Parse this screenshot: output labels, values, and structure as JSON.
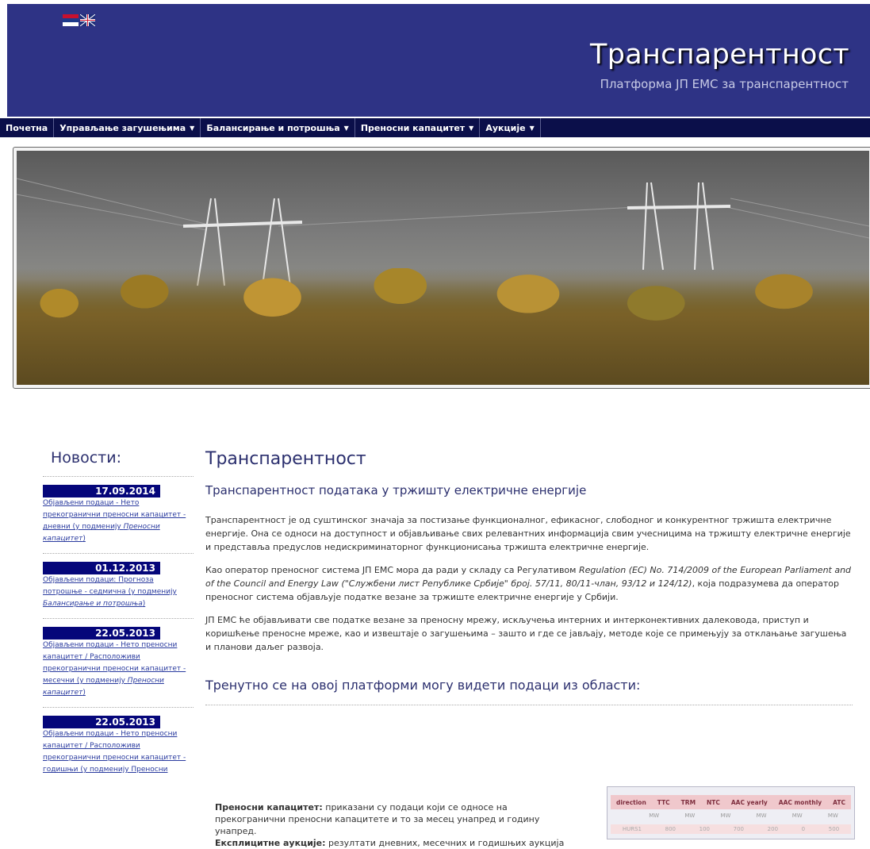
{
  "header": {
    "title": "Транспарентност",
    "subtitle": "Платформа ЈП ЕМС за транспарентност",
    "flags": [
      "serbian-flag-icon",
      "uk-flag-icon"
    ]
  },
  "nav": {
    "items": [
      {
        "label": "Почетна",
        "dropdown": false
      },
      {
        "label": "Управљање загушењима",
        "dropdown": true
      },
      {
        "label": "Балансирање и потрошња",
        "dropdown": true
      },
      {
        "label": "Преносни капацитет",
        "dropdown": true
      },
      {
        "label": "Аукције",
        "dropdown": true
      }
    ],
    "arrow": "▼"
  },
  "news": {
    "heading": "Новости:",
    "items": [
      {
        "date": "17.09.2014",
        "text": "Објављени подаци - Нето прекогранични преносни капацитет - дневни (у подменију ",
        "italic": "Преносни капацитет",
        "close": ")"
      },
      {
        "date": "01.12.2013",
        "text": "Објављени подаци: Прогноза потрошње - седмична (у подменију ",
        "italic": "Балансирање и потрошња",
        "close": ")"
      },
      {
        "date": "22.05.2013",
        "text": "Објављени подаци - Нето преносни капацитет / Расположиви прекогранични преносни капацитет - месечни (у подменију ",
        "italic": "Преносни капацитет",
        "close": ")"
      },
      {
        "date": "22.05.2013",
        "text": "Објављени подаци - Нето преносни капацитет / Расположиви прекогранични преносни капацитет - годишњи (у подменију Преносни",
        "italic": "",
        "close": ""
      }
    ]
  },
  "main": {
    "title": "Транспарентност",
    "subtitle": "Транспарентност података у тржишту електричне енергије",
    "p1": "Транспарентност је од суштинског значаја за постизање функционалног, ефикасног, слободног и конкурентног тржишта електричне енергије. Она се односи на доступност и објављивање свих релевантних информација свим учесницима на тржишту електричне енергије и представља предуслов недискриминаторног функционисања тржишта електричне енергије.",
    "p2_a": "Као оператор преносног система ЈП ЕМС мора да ради у складу са Регулативом ",
    "p2_italic": "Regulation (EC) No. 714/2009 of the European Parliament and of the Council and Energy Law (\"Службени лист Републике Србије\" број. 57/11, 80/11-члан, 93/12 и 124/12)",
    "p2_b": ", која подразумева да оператор преносног система објављује податке везане за тржиште електричне енергије у Србији.",
    "p3": "ЈП ЕМС ће објављивати све податке везане за преносну мрежу, искључења интерних и интерконективних далековода, приступ и коришћење преносне мреже, као и извештаје о загушењима – зашто и где се јављају, методе које се примењују за отклањање загушења и планови даљег развоја.",
    "section_heading": "Тренутно се на овој платформи могу видети подаци из области:",
    "bottom_1_bold": "Преносни капацитет:",
    "bottom_1": " приказани су подаци који се односе на прекогранични преносни капацитете и то за месец унапред и годину унапред.",
    "bottom_2_bold": "Експлицитне аукције:",
    "bottom_2": " резултати дневних, месечних и годишњих аукција"
  },
  "thumbnail": {
    "headers": [
      "direction",
      "TTC",
      "TRM",
      "NTC",
      "AAC yearly",
      "AAC monthly",
      "ATC"
    ],
    "units": [
      "",
      "MW",
      "MW",
      "MW",
      "MW",
      "MW",
      "MW"
    ],
    "row": [
      "HURS1",
      "800",
      "100",
      "700",
      "200",
      "0",
      "500"
    ]
  }
}
